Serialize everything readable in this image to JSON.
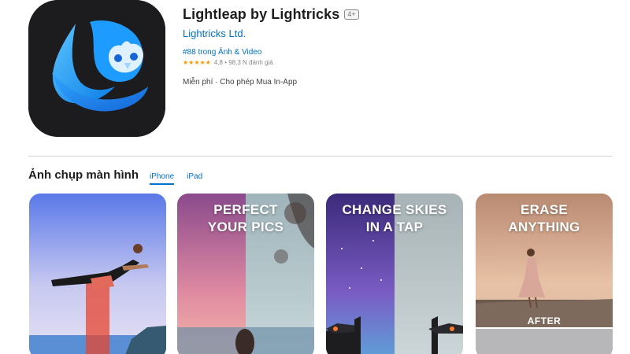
{
  "app": {
    "title": "Lightleap by Lightricks",
    "age_rating": "4+",
    "developer": "Lightricks Ltd.",
    "rank": "#88 trong Ảnh & Video",
    "stars": "★★★★★",
    "rating": "4,8",
    "ratings_count": "98,3 N đánh giá",
    "price": "Miễn phí · Cho phép Mua In-App",
    "icon": "owl-logo-icon"
  },
  "screenshots": {
    "title": "Ảnh chụp màn hình",
    "tabs": [
      "iPhone",
      "iPad"
    ],
    "active_tab": "iPhone",
    "items": [
      {
        "lines": []
      },
      {
        "lines": [
          "PERFECT",
          "YOUR PICS"
        ]
      },
      {
        "lines": [
          "CHANGE SKIES",
          "IN A TAP"
        ]
      },
      {
        "lines": [
          "ERASE",
          "ANYTHING"
        ],
        "badge": "AFTER"
      }
    ]
  },
  "colors": {
    "link": "#0070c9",
    "star": "#ff9500",
    "icon_bg": "#1c1c1e",
    "icon_blue": "#1e9bff"
  }
}
